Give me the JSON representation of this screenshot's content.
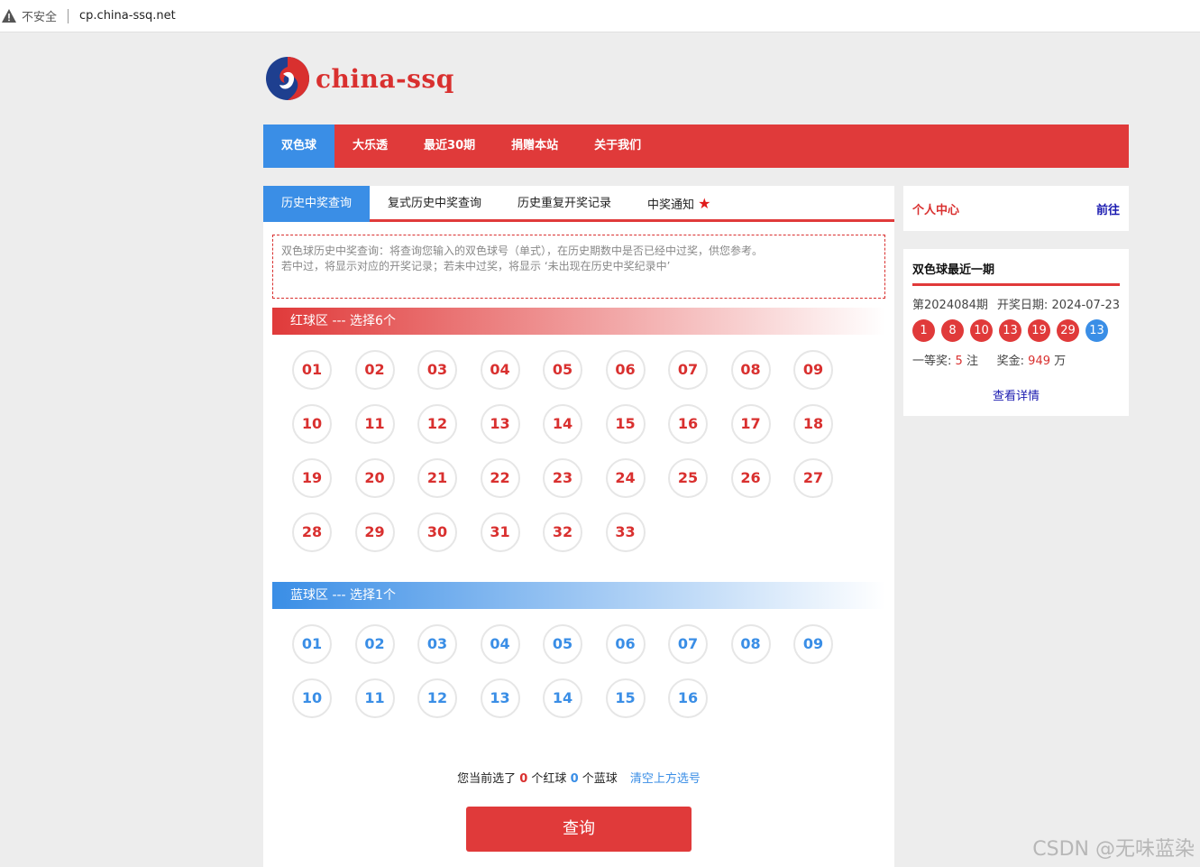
{
  "browser": {
    "security_label": "不安全",
    "url": "cp.china-ssq.net"
  },
  "logo": {
    "text": "china-ssq"
  },
  "nav": {
    "items": [
      "双色球",
      "大乐透",
      "最近30期",
      "捐赠本站",
      "关于我们"
    ],
    "active_index": 0
  },
  "tabs": {
    "items": [
      "历史中奖查询",
      "复式历史中奖查询",
      "历史重复开奖记录",
      "中奖通知"
    ],
    "active_index": 0
  },
  "notice": {
    "line1": "双色球历史中奖查询：将查询您输入的双色球号（单式），在历史期数中是否已经中过奖，供您参考。",
    "line2": "若中过，将显示对应的开奖记录；若未中过奖，将显示 ‘未出现在历史中奖纪录中’"
  },
  "red_zone": {
    "title": "红球区 --- 选择6个",
    "balls": [
      "01",
      "02",
      "03",
      "04",
      "05",
      "06",
      "07",
      "08",
      "09",
      "10",
      "11",
      "12",
      "13",
      "14",
      "15",
      "16",
      "17",
      "18",
      "19",
      "20",
      "21",
      "22",
      "23",
      "24",
      "25",
      "26",
      "27",
      "28",
      "29",
      "30",
      "31",
      "32",
      "33"
    ]
  },
  "blue_zone": {
    "title": "蓝球区 --- 选择1个",
    "balls": [
      "01",
      "02",
      "03",
      "04",
      "05",
      "06",
      "07",
      "08",
      "09",
      "10",
      "11",
      "12",
      "13",
      "14",
      "15",
      "16"
    ]
  },
  "selection": {
    "prefix": "您当前选了",
    "red_count": "0",
    "red_suffix": "个红球",
    "blue_count": "0",
    "blue_suffix": "个蓝球",
    "clear_label": "清空上方选号"
  },
  "query_button": "查询",
  "side_user": {
    "label": "个人中心",
    "link": "前往"
  },
  "side_latest": {
    "title": "双色球最近一期",
    "issue": "第2024084期",
    "date_label": "开奖日期:",
    "date": "2024-07-23",
    "red_numbers": [
      "1",
      "8",
      "10",
      "13",
      "19",
      "29"
    ],
    "blue_number": "13",
    "first_prize_label": "一等奖:",
    "first_prize_count": "5",
    "first_prize_unit": "注",
    "prize_label": "奖金:",
    "prize_value": "949",
    "prize_unit": "万",
    "detail_link": "查看详情"
  },
  "watermark": "CSDN @无味蓝染",
  "colors": {
    "red": "#e03a3a",
    "blue": "#3a8ee6"
  }
}
